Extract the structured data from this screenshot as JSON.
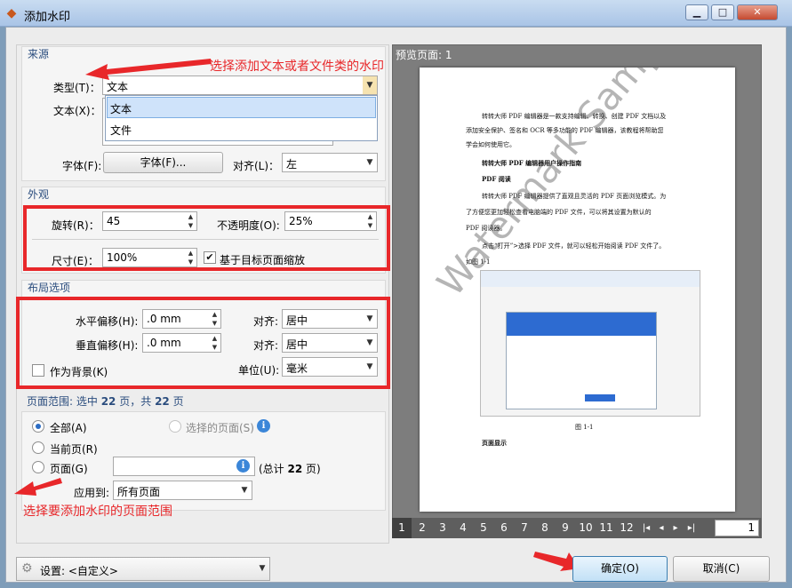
{
  "window": {
    "title": "添加水印",
    "min": "▁",
    "max": "□",
    "close": "✕"
  },
  "source": {
    "group_title": "来源",
    "type_label": "类型(T)：",
    "type_value": "文本",
    "type_options": [
      "文本",
      "文件"
    ],
    "text_label": "文本(X)：",
    "font_label": "字体(F):",
    "font_button": "字体(F)...",
    "align_label": "对齐(L)：",
    "align_value": "左"
  },
  "appearance": {
    "group_title": "外观",
    "rotation_label": "旋转(R)：",
    "rotation_value": "45",
    "opacity_label": "不透明度(O):",
    "opacity_value": "25%",
    "size_label": "尺寸(E)：",
    "size_value": "100%",
    "scale_label": "基于目标页面缩放",
    "scale_checked": true
  },
  "layout": {
    "group_title": "布局选项",
    "h_offset_label": "水平偏移(H):",
    "h_offset_value": ".0 mm",
    "h_align_label": "对齐:",
    "h_align_value": "居中",
    "v_offset_label": "垂直偏移(H):",
    "v_offset_value": ".0 mm",
    "v_align_label": "对齐:",
    "v_align_value": "居中",
    "background_label": "作为背景(K)",
    "unit_label": "单位(U):",
    "unit_value": "毫米"
  },
  "page_range": {
    "summary_prefix": "页面范围: 选中",
    "selected_count": "22",
    "summary_mid": "页，共",
    "total_count": "22",
    "summary_suffix": "页",
    "all_label": "全部(A)",
    "selected_pages_label": "选择的页面(S)",
    "current_label": "当前页(R)",
    "pages_label": "页面(G)",
    "pages_value": "",
    "total_prefix": "(总计",
    "total_suffix": "页)",
    "apply_label": "应用到:",
    "apply_value": "所有页面"
  },
  "annotations": {
    "top": "选择添加文本或者文件类的水印",
    "bottom": "选择要添加水印的页面范围"
  },
  "preview": {
    "title": "预览页面: 1",
    "watermark_text": "Watermark Sample",
    "doc_lines": [
      "转转大师 PDF 编辑器是一款支持编辑、转换、创建 PDF 文档以及",
      "添加安全保护、签名和 OCR 等多功能的 PDF 编辑器，该教程将帮助您",
      "学会如何使用它。",
      "转转大师 PDF 编辑器用户操作指南",
      "PDF 阅读",
      "转转大师 PDF 编辑器提供了直观且灵活的 PDF 页面浏览模式。为",
      "了方便您更加轻松查看电脑端的 PDF 文件，可以将其设置为默认的",
      "PDF 阅读器。",
      "点击“打开”>选择 PDF 文件，就可以轻松开始阅读 PDF 文件了。",
      "如图 1-1"
    ],
    "figure_caption": "图 1-1",
    "section_heading": "页面显示",
    "pages": [
      "1",
      "2",
      "3",
      "4",
      "5",
      "6",
      "7",
      "8",
      "9",
      "10",
      "11",
      "12"
    ],
    "current_page": "1",
    "nav_first": "|◂",
    "nav_prev": "◂",
    "nav_next": "▸",
    "nav_last": "▸|"
  },
  "footer": {
    "settings_label": "设置:",
    "settings_value": "<自定义>",
    "ok": "确定(O)",
    "cancel": "取消(C)"
  },
  "colors": {
    "accent_red": "#e8272a",
    "link_blue": "#2b4d7e",
    "select_blue": "#cfe3fa"
  }
}
